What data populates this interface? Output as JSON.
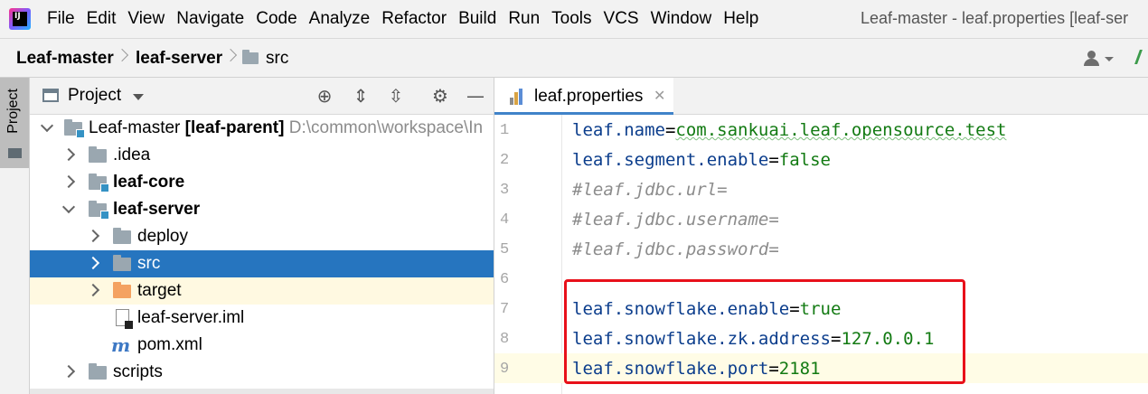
{
  "menu": {
    "items": [
      "File",
      "Edit",
      "View",
      "Navigate",
      "Code",
      "Analyze",
      "Refactor",
      "Build",
      "Run",
      "Tools",
      "VCS",
      "Window",
      "Help"
    ],
    "window_title": "Leaf-master - leaf.properties [leaf-ser"
  },
  "breadcrumb": {
    "items": [
      "Leaf-master",
      "leaf-server",
      "src"
    ]
  },
  "toolstrip": {
    "project_label": "Project"
  },
  "project_panel": {
    "title": "Project",
    "tree": [
      {
        "label": "Leaf-master",
        "suffix": "[leaf-parent]",
        "path": "D:\\common\\workspace\\In"
      },
      {
        "label": ".idea"
      },
      {
        "label": "leaf-core"
      },
      {
        "label": "leaf-server"
      },
      {
        "label": "deploy"
      },
      {
        "label": "src"
      },
      {
        "label": "target"
      },
      {
        "label": "leaf-server.iml"
      },
      {
        "label": "pom.xml"
      },
      {
        "label": "scripts"
      }
    ]
  },
  "editor": {
    "tab_label": "leaf.properties",
    "lines": [
      {
        "num": "1",
        "key": "leaf.name",
        "eq": "=",
        "value": "com.sankuai.leaf.opensource.test"
      },
      {
        "num": "2",
        "key": "leaf.segment.enable",
        "eq": "=",
        "value": "false"
      },
      {
        "num": "3",
        "comment": "#leaf.jdbc.url="
      },
      {
        "num": "4",
        "comment": "#leaf.jdbc.username="
      },
      {
        "num": "5",
        "comment": "#leaf.jdbc.password="
      },
      {
        "num": "6"
      },
      {
        "num": "7",
        "key": "leaf.snowflake.enable",
        "eq": "=",
        "value": "true"
      },
      {
        "num": "8",
        "key": "leaf.snowflake.zk.address",
        "eq": "=",
        "value": "127.0.0.1"
      },
      {
        "num": "9",
        "key": "leaf.snowflake.port",
        "eq": "=",
        "value": "2181"
      }
    ]
  },
  "colors": {
    "selection": "#2675bf",
    "highlight_box": "#e8101a",
    "value_green": "#127a12",
    "key_blue": "#0b3d8c"
  }
}
